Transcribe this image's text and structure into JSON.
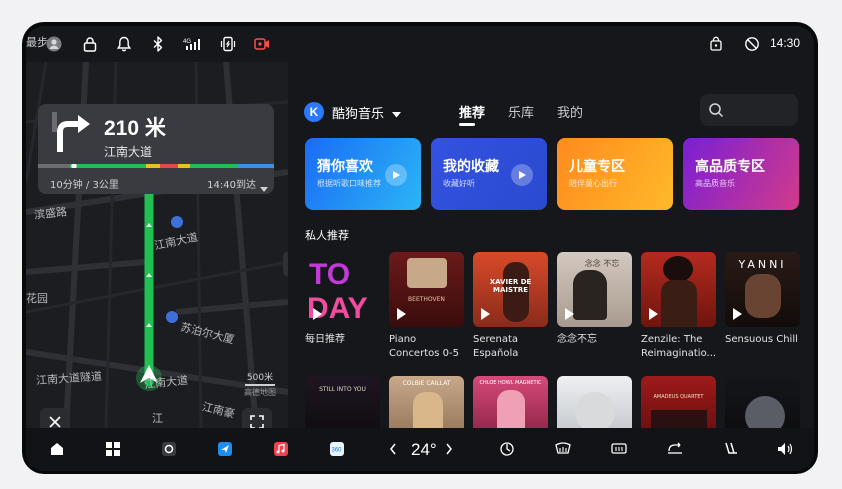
{
  "status_bar": {
    "user_text": "最步步",
    "time": "14:30",
    "signal_text": "4G"
  },
  "navigation": {
    "distance": "210 米",
    "road": "江南大道",
    "eta": "10分钟 / 3公里",
    "arrival": "14:40到达",
    "scale": "500米",
    "scale_source": "高德地图",
    "map_labels": [
      "滨盛路",
      "江南大道",
      "苏泊尔大厦",
      "江南大道隧道",
      "江南大道",
      "江南豪",
      "花园",
      "江"
    ]
  },
  "music": {
    "app_name": "酷狗音乐",
    "tabs": [
      "推荐",
      "乐库",
      "我的"
    ],
    "features": [
      {
        "title": "猜你喜欢",
        "subtitle": "根据听歌口味推荐"
      },
      {
        "title": "我的收藏",
        "subtitle": "收藏好听"
      },
      {
        "title": "儿童专区",
        "subtitle": "陪伴童心出行"
      },
      {
        "title": "高品质专区",
        "subtitle": "高品质音乐"
      }
    ],
    "section_title": "私人推荐",
    "row1": [
      {
        "label": "每日推荐",
        "cover_text": "TODAY"
      },
      {
        "label": "Piano Concertos 0-5",
        "cover_text": "BEETHOVEN"
      },
      {
        "label": "Serenata Española",
        "cover_text": "XAVIER DE MAISTRE"
      },
      {
        "label": "念念不忘",
        "cover_text": "念念 不忘"
      },
      {
        "label": "Zenzile: The Reimaginatio...",
        "cover_text": ""
      },
      {
        "label": "Sensuous Chill",
        "cover_text": "YANNI"
      }
    ],
    "row2_covers": [
      "STILL INTO YOU",
      "COLBIE CAILLAT",
      "CHLOE HOWL MAGNETIC",
      "",
      "AMADEUS QUARTET",
      ""
    ]
  },
  "dock": {
    "temperature": "24°"
  },
  "colors": {
    "route_green": "#1fbf52",
    "accent_blue": "#2a79ff"
  }
}
